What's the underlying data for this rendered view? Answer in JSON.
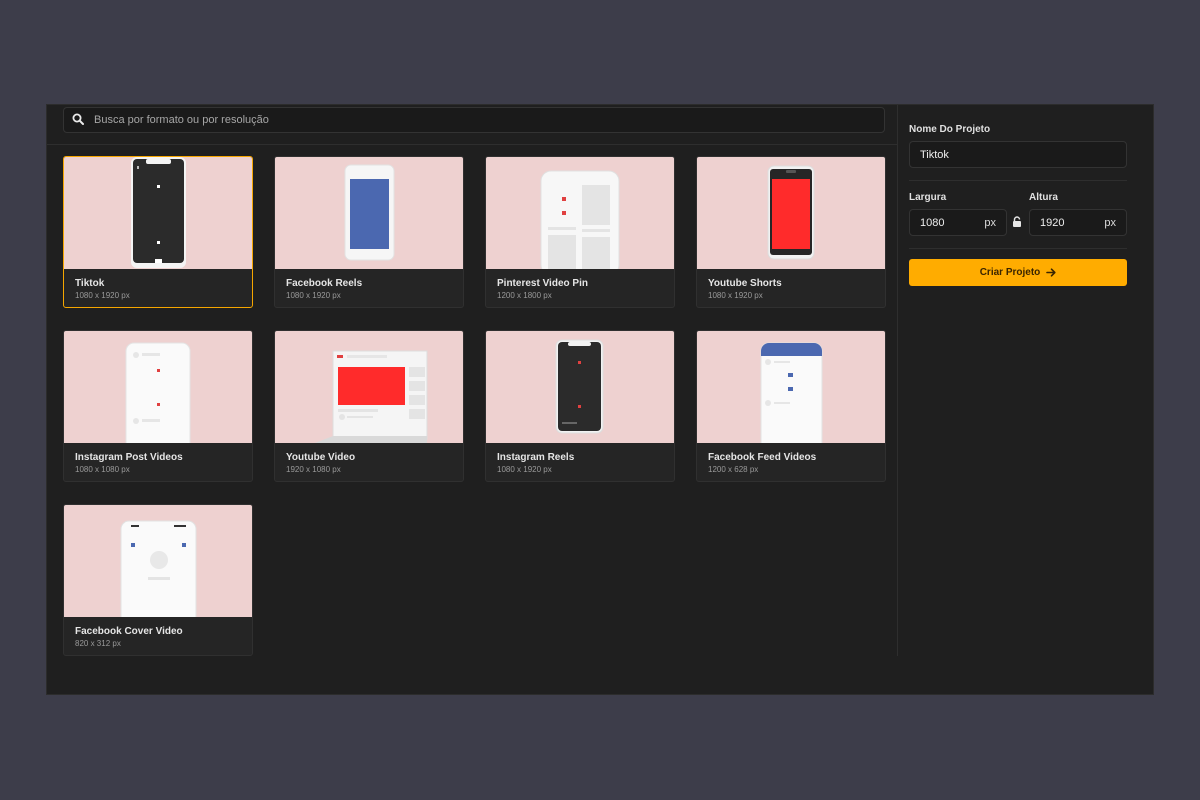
{
  "search": {
    "placeholder": "Busca por formato ou por resolução"
  },
  "formats": [
    {
      "title": "Tiktok",
      "resolution": "1080 x 1920 px",
      "selected": true
    },
    {
      "title": "Facebook Reels",
      "resolution": "1080 x 1920 px"
    },
    {
      "title": "Pinterest Video Pin",
      "resolution": "1200 x 1800 px"
    },
    {
      "title": "Youtube Shorts",
      "resolution": "1080 x 1920 px"
    },
    {
      "title": "Instagram Post Videos",
      "resolution": "1080 x 1080 px"
    },
    {
      "title": "Youtube Video",
      "resolution": "1920 x 1080 px"
    },
    {
      "title": "Instagram Reels",
      "resolution": "1080 x 1920 px"
    },
    {
      "title": "Facebook Feed Videos",
      "resolution": "1200 x 628 px"
    },
    {
      "title": "Facebook Cover Video",
      "resolution": "820 x 312 px"
    }
  ],
  "project": {
    "name_label": "Nome Do Projeto",
    "name_value": "Tiktok",
    "width_label": "Largura",
    "width_value": "1080",
    "height_label": "Altura",
    "height_value": "1920",
    "unit": "px",
    "create_label": "Criar Projeto",
    "create_icon": "arrow-right-icon",
    "lock_icon": "lock-icon"
  },
  "colors": {
    "accent": "#ffac00",
    "panel": "#1f1f1f",
    "backdrop": "#3d3d4a",
    "thumb_bg": "#eed1d0",
    "mock_red": "#ff2b2b",
    "mock_blue": "#4b68b0"
  }
}
